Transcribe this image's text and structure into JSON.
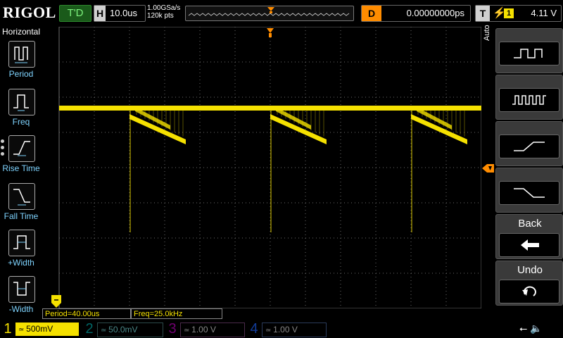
{
  "brand": "RIGOL",
  "run_state": "T'D",
  "horizontal": {
    "label": "H",
    "timebase": "10.0us"
  },
  "sample": {
    "rate": "1.00GSa/s",
    "points": "120k pts"
  },
  "delay": {
    "label": "D",
    "value": "0.00000000ps"
  },
  "trigger": {
    "label": "T",
    "edge_icon": "rising-edge-icon",
    "source": "1",
    "level": "4.11 V"
  },
  "left_menu": {
    "title": "Horizontal",
    "items": [
      {
        "label": "Period",
        "icon": "period-icon"
      },
      {
        "label": "Freq",
        "icon": "freq-icon"
      },
      {
        "label": "Rise Time",
        "icon": "rise-time-icon"
      },
      {
        "label": "Fall Time",
        "icon": "fall-time-icon"
      },
      {
        "label": "+Width",
        "icon": "pos-width-icon"
      },
      {
        "label": "-Width",
        "icon": "neg-width-icon"
      }
    ]
  },
  "softkeys": {
    "mode": "Auto",
    "back_label": "Back",
    "undo_label": "Undo"
  },
  "measurements": [
    {
      "text": "Period=40.00us"
    },
    {
      "text": "Freq=25.0kHz"
    }
  ],
  "channels": [
    {
      "num": "1",
      "scale": "500mV",
      "color": "#f5e100",
      "active": true
    },
    {
      "num": "2",
      "scale": "50.0mV",
      "color": "#00c8c8",
      "active": false
    },
    {
      "num": "3",
      "scale": "1.00 V",
      "color": "#e000e0",
      "active": false
    },
    {
      "num": "4",
      "scale": "1.00 V",
      "color": "#1e64ff",
      "active": false
    }
  ],
  "colors": {
    "trace": "#f5e100",
    "grid": "#6a6a6a",
    "trigger_marker": "#ff8c00"
  }
}
